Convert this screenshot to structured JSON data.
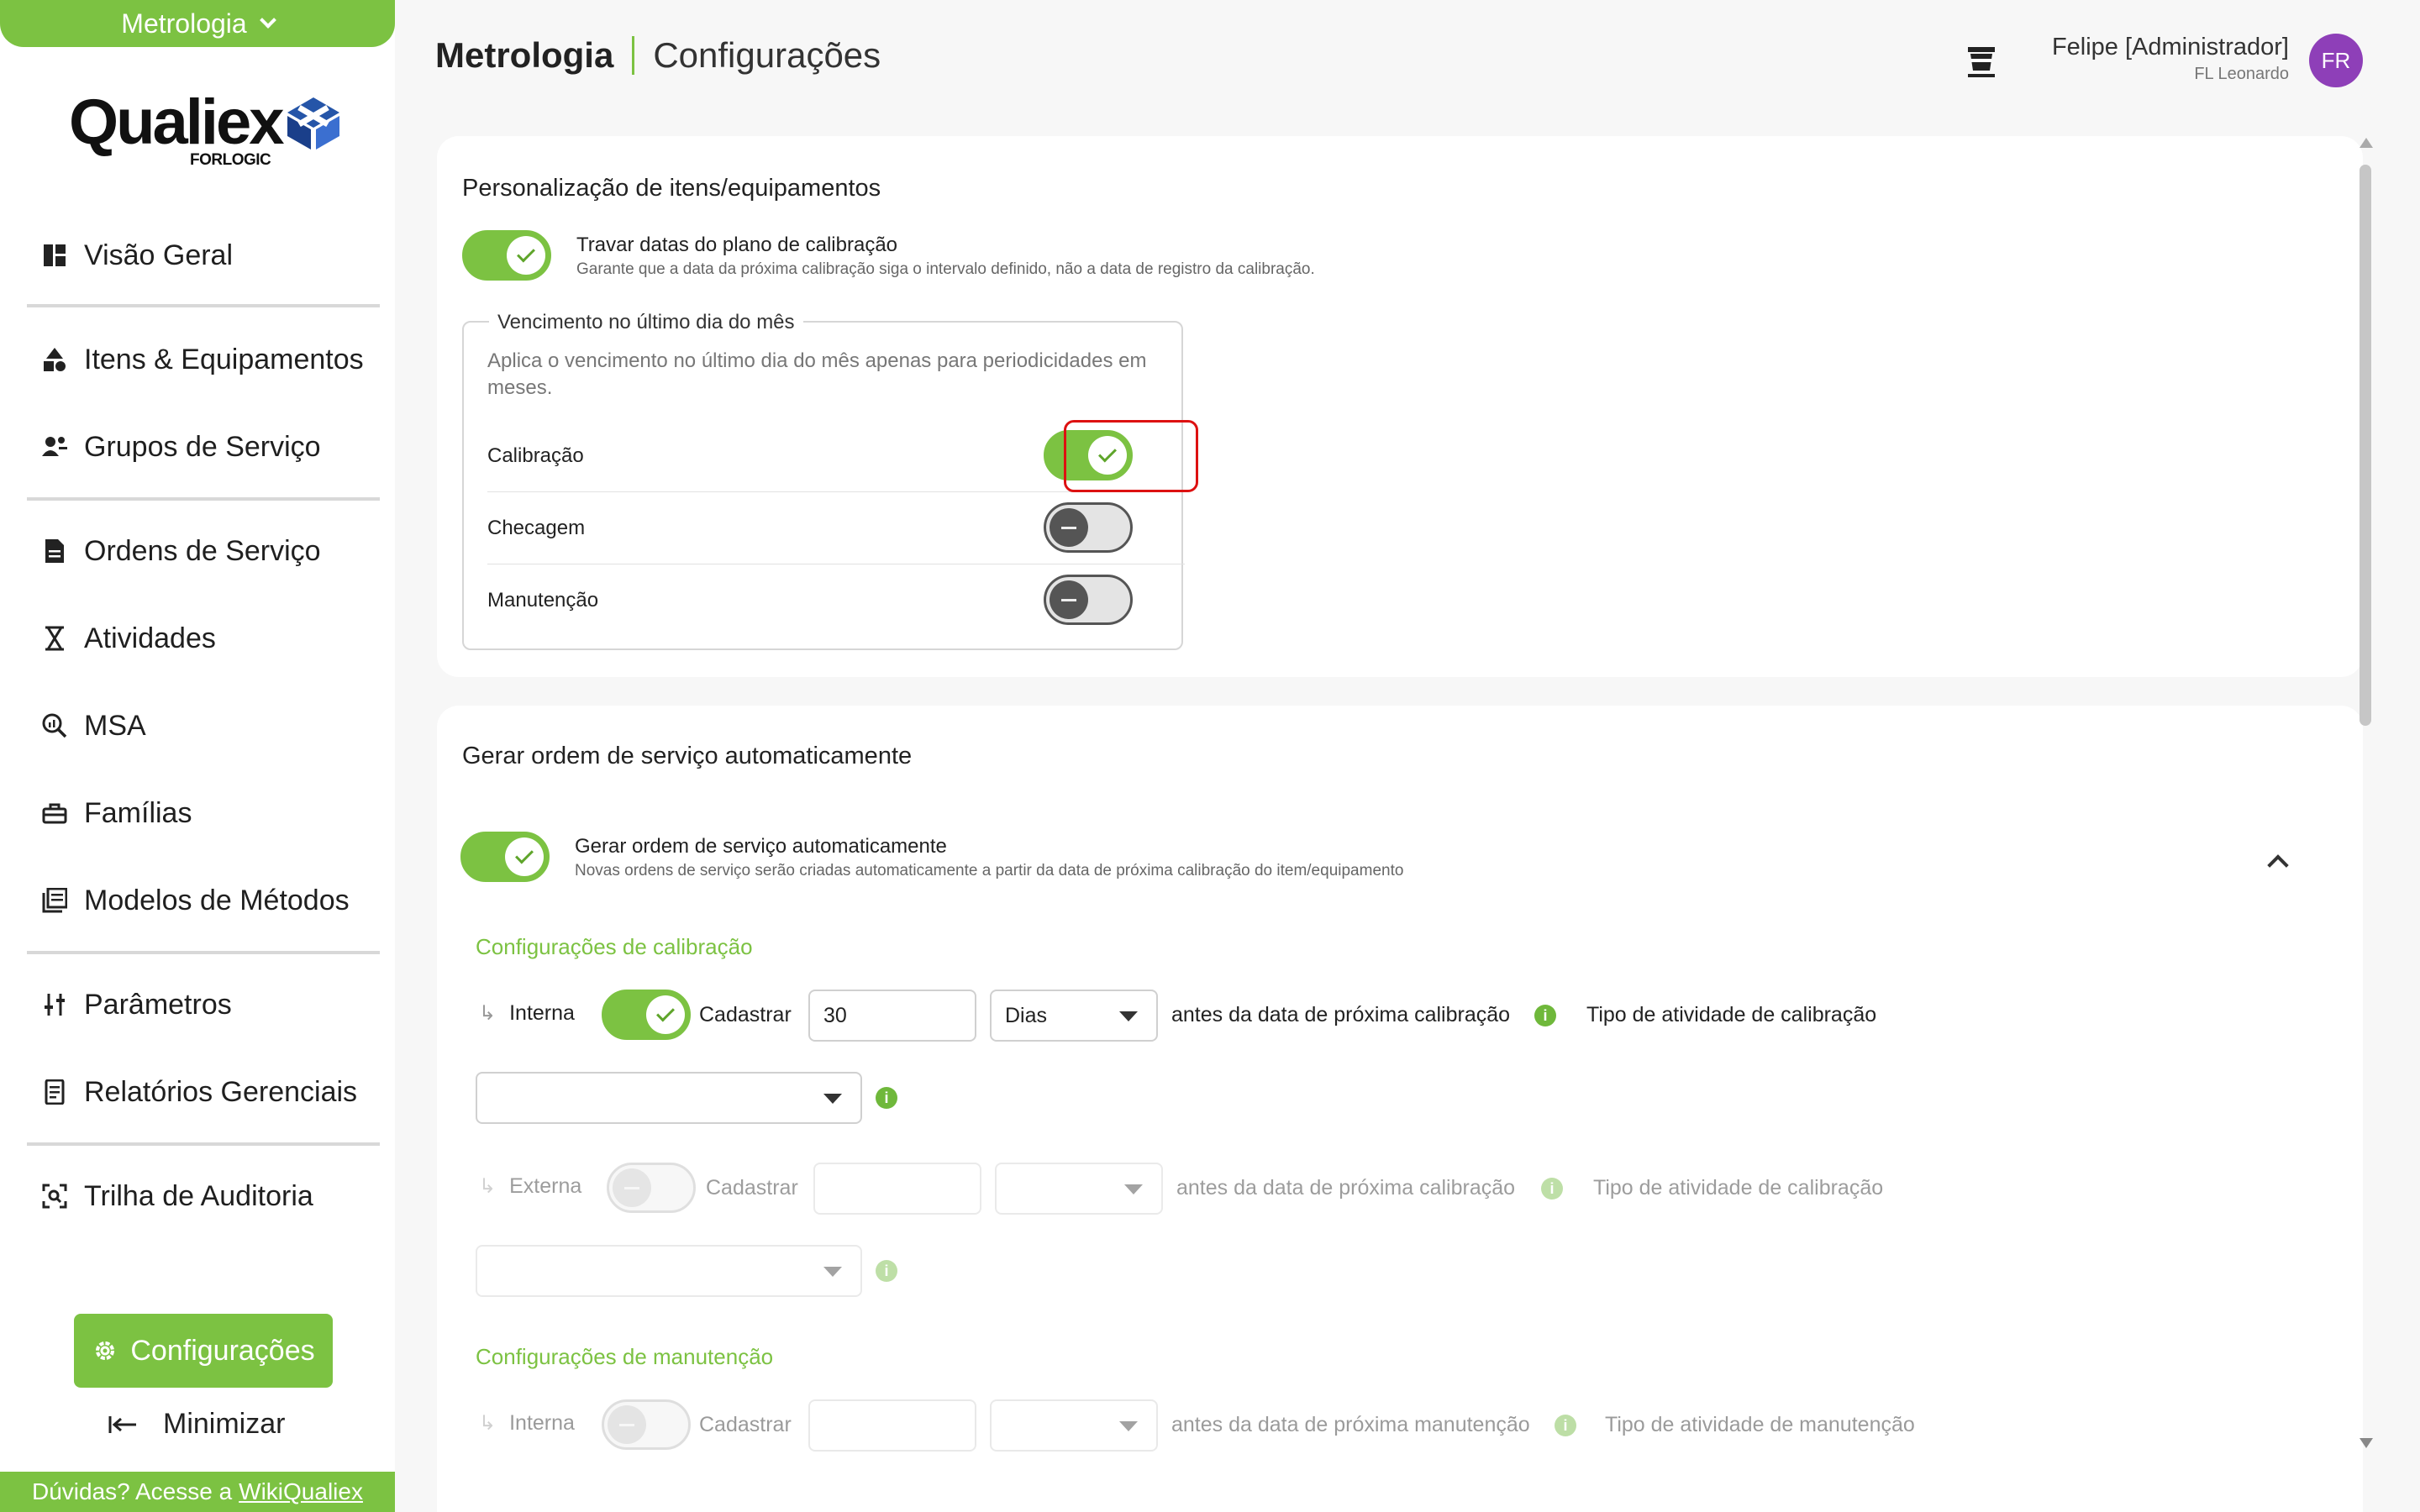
{
  "sidebar": {
    "module": "Metrologia",
    "logo": {
      "word": "Qualiex",
      "sub": "FORLOGIC"
    },
    "items": [
      {
        "label": "Visão Geral"
      },
      {
        "label": "Itens & Equipamentos"
      },
      {
        "label": "Grupos de Serviço"
      },
      {
        "label": "Ordens de Serviço"
      },
      {
        "label": "Atividades"
      },
      {
        "label": "MSA"
      },
      {
        "label": "Famílias"
      },
      {
        "label": "Modelos de Métodos"
      },
      {
        "label": "Parâmetros"
      },
      {
        "label": "Relatórios Gerenciais"
      },
      {
        "label": "Trilha de Auditoria"
      }
    ],
    "config_label": "Configurações",
    "minimize_label": "Minimizar",
    "help_text": "Dúvidas? Acesse a",
    "help_link": "WikiQualiex"
  },
  "header": {
    "title": "Metrologia",
    "subtitle": "Configurações",
    "user_name": "Felipe [Administrador]",
    "user_org": "FL Leonardo",
    "avatar_initials": "FR"
  },
  "section1": {
    "title": "Personalização de itens/equipamentos",
    "lock_label": "Travar datas do plano de calibração",
    "lock_desc": "Garante que a data da próxima calibração siga o intervalo definido, não a data de registro da calibração.",
    "lock_on": true,
    "fieldset_legend": "Vencimento no último dia do mês",
    "fieldset_desc": "Aplica o vencimento no último dia do mês apenas para periodicidades em meses.",
    "rows": [
      {
        "label": "Calibração",
        "on": true
      },
      {
        "label": "Checagem",
        "on": false
      },
      {
        "label": "Manutenção",
        "on": false
      }
    ]
  },
  "section2": {
    "title": "Gerar ordem de serviço automaticamente",
    "auto_label": "Gerar ordem de serviço automaticamente",
    "auto_desc": "Novas ordens de serviço serão criadas automaticamente a partir da data de próxima calibração do item/equipamento",
    "calib_heading": "Configurações de calibração",
    "maint_heading": "Configurações de manutenção",
    "register_label": "Cadastrar",
    "internal": {
      "label": "Interna",
      "days_value": "30",
      "unit_value": "Dias",
      "before_text": "antes da data de próxima calibração",
      "type_text": "Tipo de atividade de calibração"
    },
    "external": {
      "label": "Externa",
      "before_text": "antes da data de próxima calibração",
      "type_text": "Tipo de atividade de calibração"
    },
    "maint_internal": {
      "label": "Interna",
      "before_text": "antes da data de próxima manutenção",
      "type_text": "Tipo de atividade de manutenção"
    },
    "info_glyph": "i"
  },
  "colors": {
    "accent": "#7cc242",
    "avatar": "#8e3fb8",
    "highlight": "#dd1111"
  }
}
